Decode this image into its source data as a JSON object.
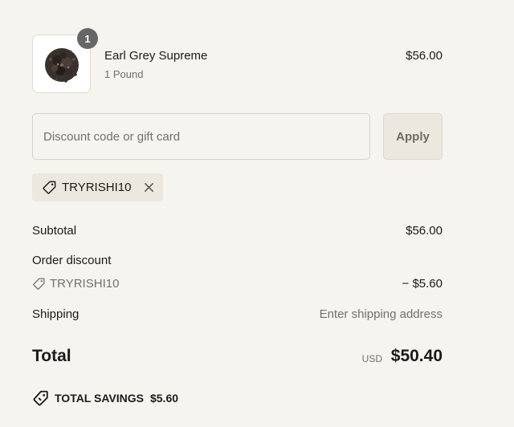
{
  "cart_item": {
    "quantity": "1",
    "name": "Earl Grey Supreme",
    "variant": "1 Pound",
    "price": "$56.00",
    "image_icon": "loose-leaf-tea-icon"
  },
  "discount": {
    "placeholder": "Discount code or gift card",
    "value": "",
    "apply_label": "Apply",
    "applied_code": "TRYRISHI10"
  },
  "summary": {
    "subtotal_label": "Subtotal",
    "subtotal_value": "$56.00",
    "order_discount_label": "Order discount",
    "order_discount_code": "TRYRISHI10",
    "order_discount_amount": "− $5.60",
    "shipping_label": "Shipping",
    "shipping_value": "Enter shipping address",
    "total_label": "Total",
    "total_currency": "USD",
    "total_value": "$50.40"
  },
  "savings": {
    "label": "TOTAL SAVINGS",
    "amount": "$5.60"
  },
  "colors": {
    "background": "#f5f4ef",
    "button_bg": "#ece8df",
    "badge": "#666666",
    "muted_text": "#707070"
  }
}
